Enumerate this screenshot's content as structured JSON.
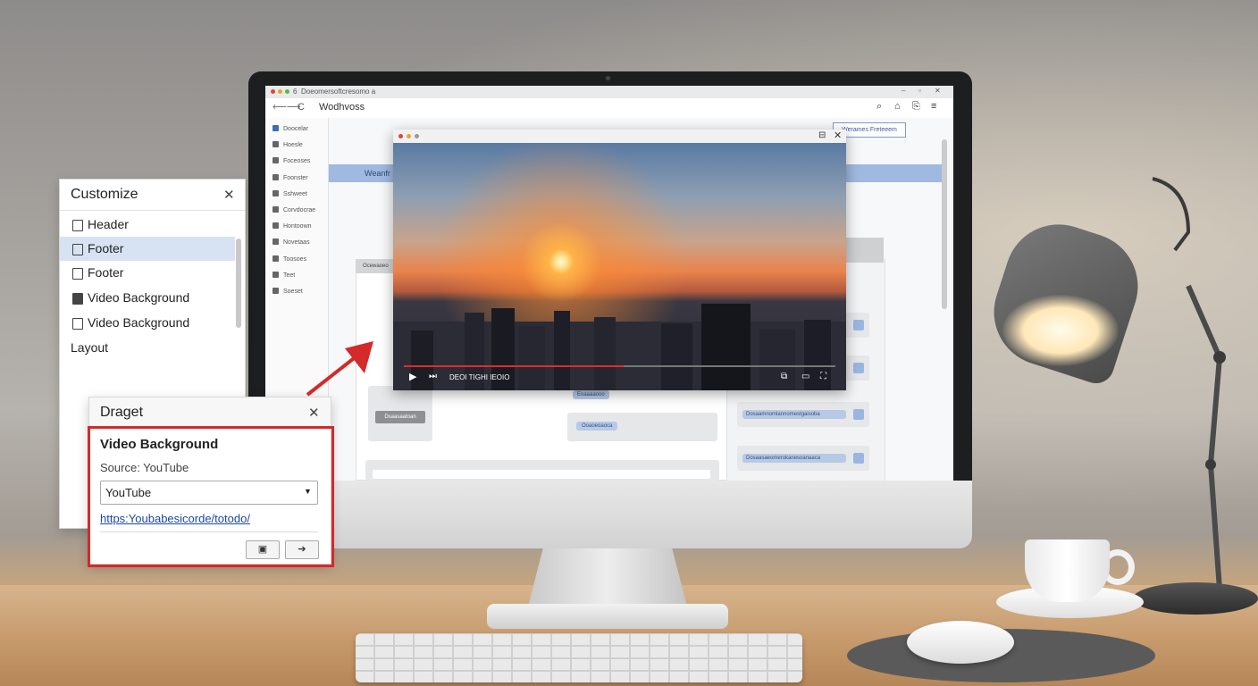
{
  "browser": {
    "tab_title": "Doeomersoftcresomo a",
    "tab_count": "6",
    "address": "Wodhvoss",
    "top_right_button": "Werames Freteeem",
    "sidebar": [
      {
        "label": "Doocelar",
        "icon": "shield-icon"
      },
      {
        "label": "Hoesle",
        "icon": "page-icon"
      },
      {
        "label": "Foceoses",
        "icon": "sliders-icon"
      },
      {
        "label": "Foonster",
        "icon": "gear-icon"
      },
      {
        "label": "Sshweet",
        "icon": "tools-icon"
      },
      {
        "label": "Corvdocrae",
        "icon": "page-icon"
      },
      {
        "label": "Hontoown",
        "icon": "grid-icon"
      },
      {
        "label": "Novetaas",
        "icon": "layout-icon"
      },
      {
        "label": "Toosoes",
        "icon": "layout-icon"
      },
      {
        "label": "Teet",
        "icon": "layout-icon"
      },
      {
        "label": "Soeset",
        "icon": "layout-icon"
      }
    ],
    "blue_bar_text": "Weanfr",
    "panel_header": "Ocewaoeo",
    "gray_button": "Dsaasaatoan",
    "pill_left": "Eoaaaaooo",
    "pill_mid": "Ooaoeoaoca",
    "rows": [
      "Dosaamnomlannomestgaisoba",
      "Dosaasaeomerokanesoanaaca"
    ]
  },
  "video": {
    "controls_text": "DEOI TIGHI IEOIO",
    "progress_percent": 51
  },
  "customize": {
    "title": "Customize",
    "items": [
      {
        "label": "Header",
        "icon": "page-icon",
        "selected": false
      },
      {
        "label": "Footer",
        "icon": "page-icon",
        "selected": true
      },
      {
        "label": "Footer",
        "icon": "page-icon",
        "selected": false
      },
      {
        "label": "Video Background",
        "icon": "film-icon",
        "selected": false
      },
      {
        "label": "Video Background",
        "icon": "square-icon",
        "selected": false
      },
      {
        "label": "Layout",
        "icon": "",
        "selected": false
      }
    ]
  },
  "draget": {
    "title": "Draget",
    "section_title": "Video Background",
    "source_label": "Source: YouTube",
    "select_value": "YouTube",
    "url": "https:Youbabesicorde/totodo/"
  },
  "colors": {
    "highlight_red": "#d42a2a",
    "selection_blue": "#d7e3f3",
    "accent_blue": "#9fb9e0"
  }
}
